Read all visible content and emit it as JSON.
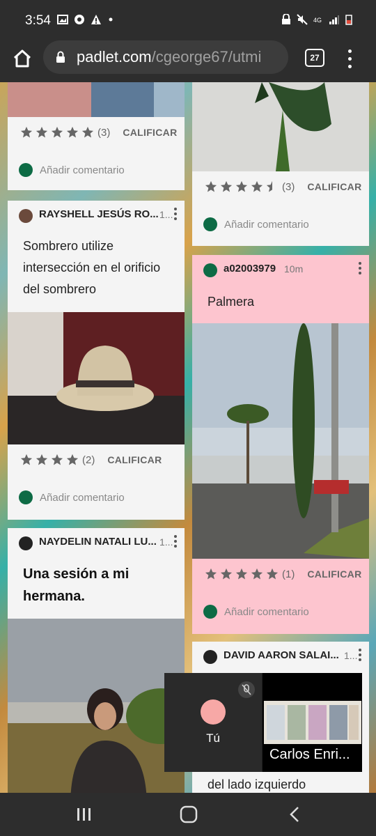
{
  "status": {
    "time": "3:54",
    "left_icons": [
      "gallery-icon",
      "chrome-icon",
      "warning-icon",
      "dot-icon"
    ],
    "right_icons": [
      "lock-icon",
      "mute-icon",
      "signal-4g-icon",
      "signal-icon",
      "battery-icon"
    ]
  },
  "browser": {
    "url_host": "padlet.com",
    "url_rest": "/cgeorge67/utmi",
    "tab_count": "27"
  },
  "cards": {
    "c1": {
      "rating_count": "(3)",
      "rating_stars": 5,
      "rate_label": "CALIFICAR",
      "comment_placeholder": "Añadir comentario"
    },
    "c2": {
      "author": "RAYSHELL JESÚS RO...",
      "time": "1...",
      "body": "Sombrero utilize intersección en el orificio del sombrero",
      "rating_count": "(2)",
      "rating_stars": 4,
      "rate_label": "CALIFICAR",
      "comment_placeholder": "Añadir comentario"
    },
    "c3": {
      "author": "NAYDELIN NATALI LU...",
      "time": "1...",
      "subject": "Una sesión a mi hermana."
    },
    "c4": {
      "rating_count": "(3)",
      "rating_stars": 4.5,
      "rate_label": "CALIFICAR",
      "comment_placeholder": "Añadir comentario"
    },
    "c5": {
      "author": "a02003979",
      "time": "10m",
      "body": "Palmera",
      "rating_count": "(1)",
      "rating_stars": 5,
      "rate_label": "CALIFICAR",
      "comment_placeholder": "Añadir comentario"
    },
    "c6": {
      "author": "DAVID AARON SALAI...",
      "time": "1...",
      "body_tail": "del lado izquierdo"
    }
  },
  "meet": {
    "self_label": "Tú",
    "other_name": "Carlos Enri..."
  },
  "nav": {
    "icons": [
      "recents-icon",
      "home-icon",
      "back-icon"
    ]
  },
  "colors": {
    "pink_card": "#fdc5cf",
    "avatar_green": "#0d6b45"
  }
}
